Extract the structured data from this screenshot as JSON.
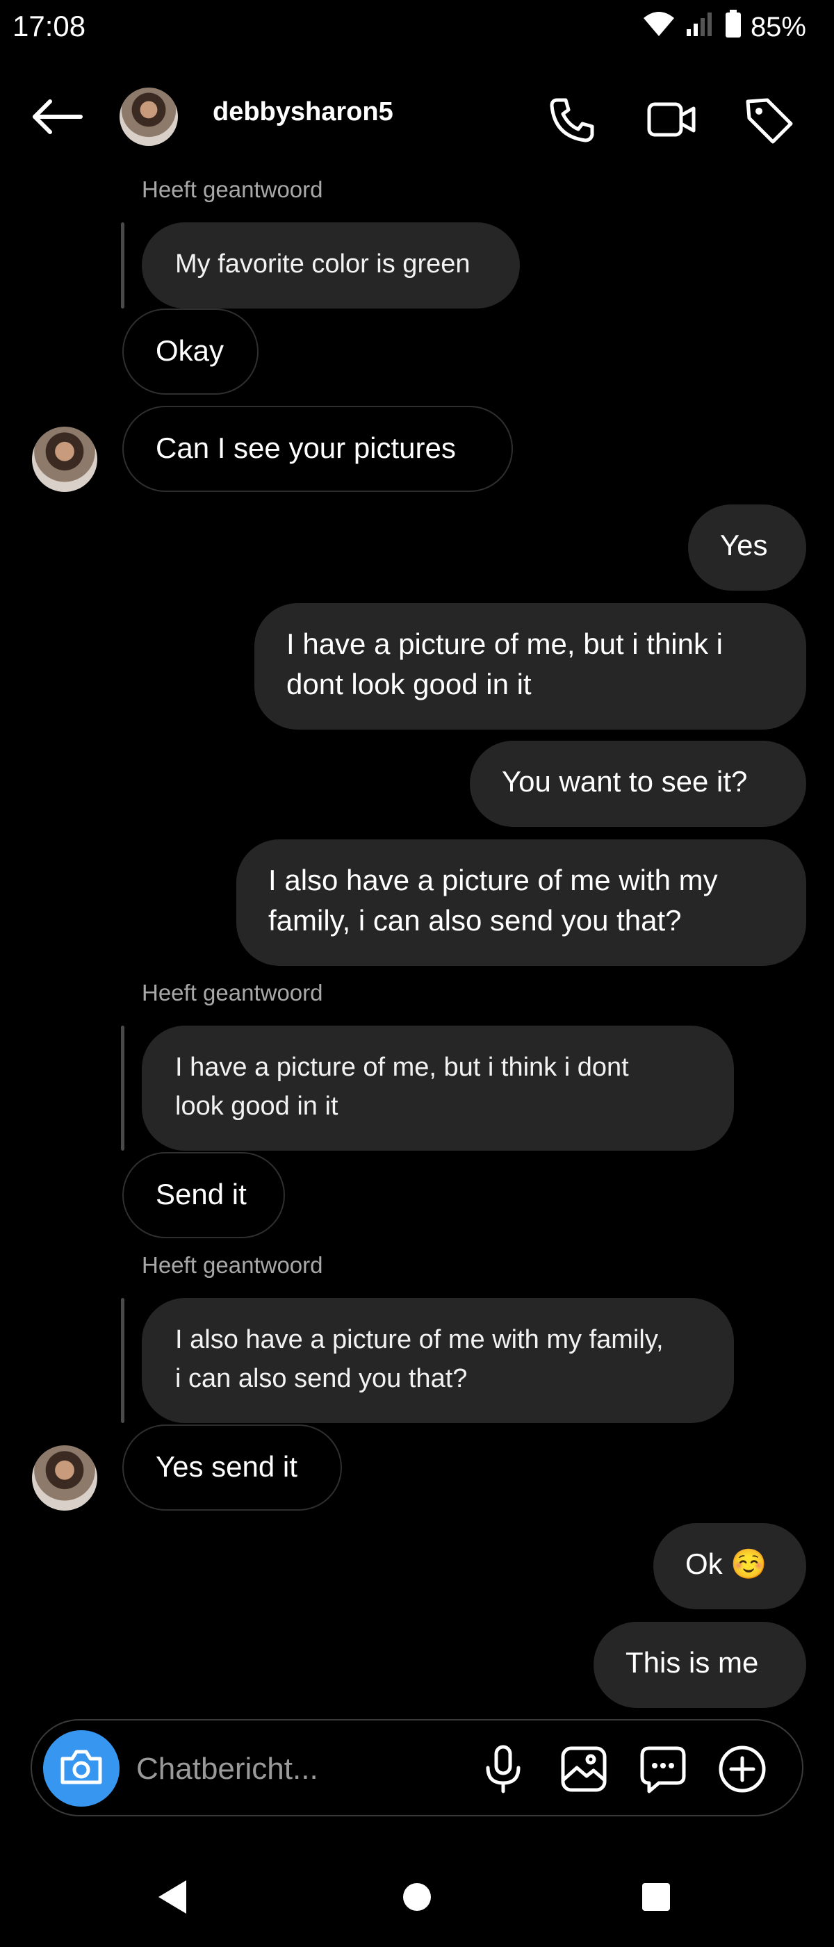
{
  "status_bar": {
    "time": "17:08",
    "battery": "85%"
  },
  "header": {
    "username": "debbysharon5"
  },
  "messages": {
    "reply_label": "Heeft geantwoord",
    "m1_quote": "My favorite color is green",
    "m2": "Okay",
    "m3": "Can I see your pictures",
    "m4": "Yes",
    "m5_line1": "I have a picture of me, but i think i",
    "m5_line2": "dont look good in it",
    "m6": "You want to see it?",
    "m7_line1": "I also have a picture of me with my",
    "m7_line2": "family, i can also send you that?",
    "m8_quote_line1": "I have a picture of me, but i think i dont",
    "m8_quote_line2": "look good in it",
    "m9": "Send it",
    "m10_quote_line1": "I also have a picture of me with my family,",
    "m10_quote_line2": "i can also send you that?",
    "m11": "Yes send it",
    "m12": "Ok ☺️",
    "m13": "This is me"
  },
  "composer": {
    "placeholder": "Chatbericht..."
  },
  "colors": {
    "background": "#000000",
    "bubble_out": "#262626",
    "camera_button": "#3797f0",
    "reply_label": "#a8a8a8"
  }
}
